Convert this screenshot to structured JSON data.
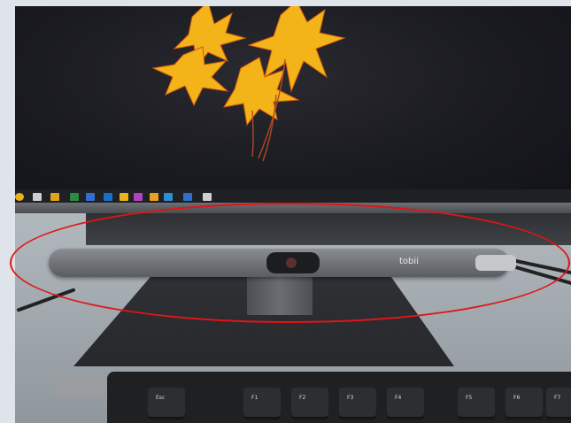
{
  "photo": {
    "tracker_brand": "tobii",
    "keys": [
      "Esc",
      "F1",
      "F2",
      "F3",
      "F4",
      "F5",
      "F6",
      "F7"
    ],
    "annotation_color": "#e01515",
    "taskbar_icon_colors": [
      "#e8b21a",
      "#cfcfcf",
      "#e3a21a",
      "#2d8a3e",
      "#2f6fd0",
      "#1a70c8",
      "#e8b21a",
      "#b042c0",
      "#e8a020",
      "#2d8fd5",
      "#2f6fd0",
      "#cfcfcf"
    ]
  }
}
